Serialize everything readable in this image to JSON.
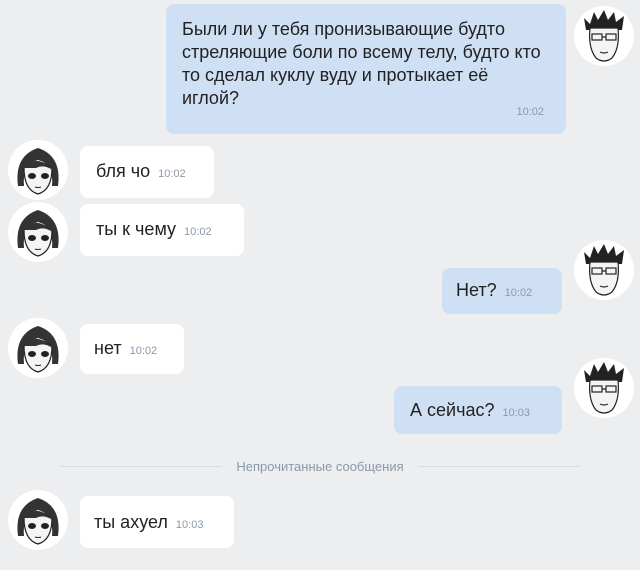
{
  "messages": [
    {
      "dir": "out",
      "text": "Были ли у тебя пронизывающие будто стреляющие боли по всему телу, будто кто то сделал куклу вуду и протыкает её иглой?",
      "time": "10:02"
    },
    {
      "dir": "in",
      "text": "бля чо",
      "time": "10:02"
    },
    {
      "dir": "in",
      "text": "ты к чему",
      "time": "10:02"
    },
    {
      "dir": "out",
      "text": "Нет?",
      "time": "10:02"
    },
    {
      "dir": "in",
      "text": "нет",
      "time": "10:02"
    },
    {
      "dir": "out",
      "text": "А сейчас?",
      "time": "10:03"
    },
    {
      "dir": "in",
      "text": "ты ахуел",
      "time": "10:03"
    }
  ],
  "divider": {
    "label": "Непрочитанные сообщения"
  },
  "colors": {
    "background": "#edeef0",
    "incoming_bubble": "#ffffff",
    "outgoing_bubble": "#cfe0f4",
    "timestamp": "#8a99aa"
  },
  "avatars": {
    "incoming": "girl-avatar-icon",
    "outgoing": "man-avatar-icon"
  }
}
